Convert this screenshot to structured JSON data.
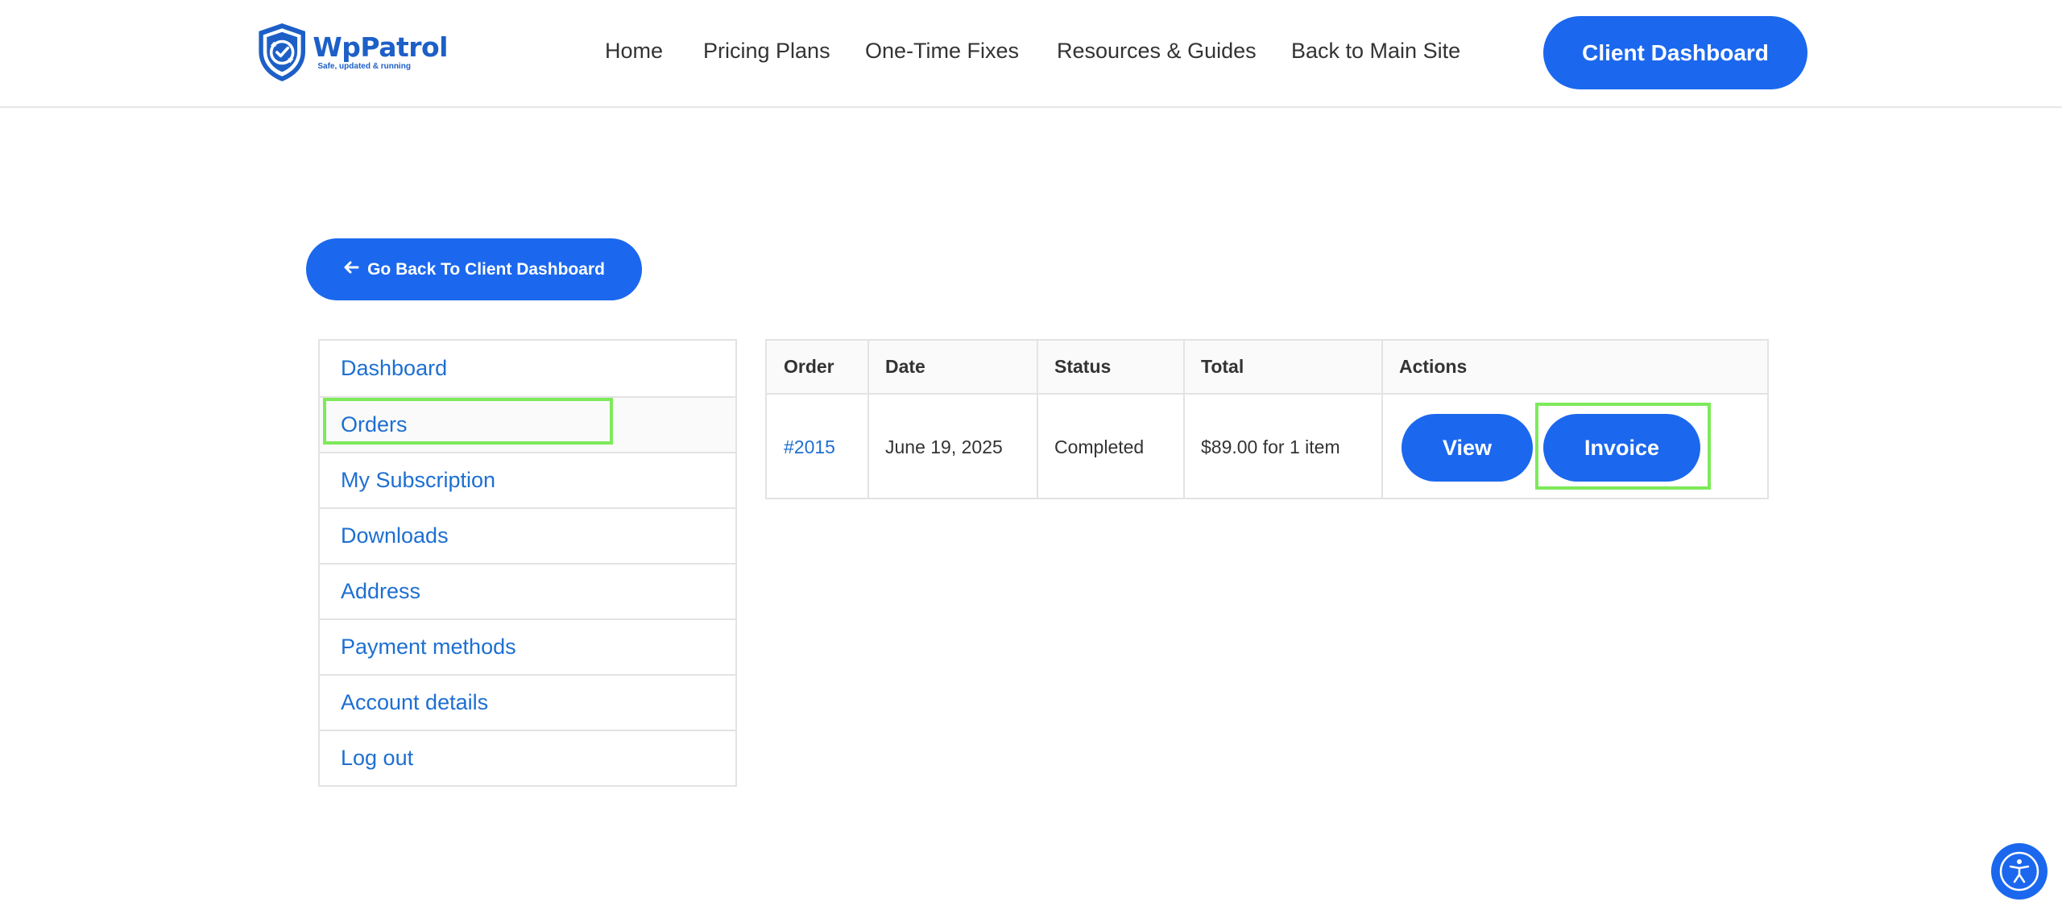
{
  "brand": {
    "name": "WpPatrol",
    "tagline": "Safe, updated & running",
    "color": "#1d5fc7"
  },
  "nav": {
    "items": [
      {
        "label": "Home"
      },
      {
        "label": "Pricing Plans"
      },
      {
        "label": "One-Time Fixes"
      },
      {
        "label": "Resources & Guides"
      },
      {
        "label": "Back to Main Site"
      }
    ],
    "cta_label": "Client Dashboard"
  },
  "back_button": {
    "label": "Go Back To Client Dashboard",
    "icon": "arrow-left-icon"
  },
  "sidebar": {
    "items": [
      {
        "label": "Dashboard"
      },
      {
        "label": "Orders",
        "active": true
      },
      {
        "label": "My Subscription"
      },
      {
        "label": "Downloads"
      },
      {
        "label": "Address"
      },
      {
        "label": "Payment methods"
      },
      {
        "label": "Account details"
      },
      {
        "label": "Log out"
      }
    ]
  },
  "orders_table": {
    "headers": [
      "Order",
      "Date",
      "Status",
      "Total",
      "Actions"
    ],
    "rows": [
      {
        "order": "#2015",
        "date": "June 19, 2025",
        "status": "Completed",
        "total": "$89.00 for 1 item",
        "actions": {
          "view": "View",
          "invoice": "Invoice"
        }
      }
    ]
  },
  "accessibility_widget": {
    "icon": "accessibility-icon"
  },
  "colors": {
    "primary_button": "#1b68ee",
    "link": "#1d6fd1",
    "highlight_outline": "#7dea5a"
  }
}
